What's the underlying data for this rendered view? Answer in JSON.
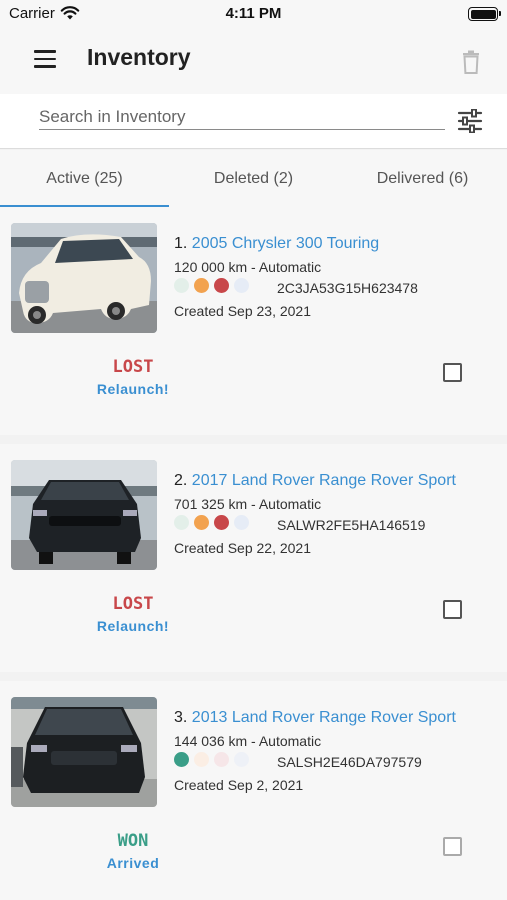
{
  "status_bar": {
    "carrier": "Carrier",
    "time": "4:11 PM"
  },
  "app_bar": {
    "title": "Inventory",
    "menu_icon": "menu-icon",
    "trash_icon": "trash-icon"
  },
  "search": {
    "placeholder": "Search in Inventory",
    "value": "",
    "filter_icon": "sliders-icon"
  },
  "tabs": [
    {
      "label": "Active (25)",
      "active": true
    },
    {
      "label": "Deleted (2)",
      "active": false
    },
    {
      "label": "Delivered (6)",
      "active": false
    }
  ],
  "colors": {
    "accent": "#3a8fd1",
    "lost": "#c8474a",
    "won": "#3a9e88"
  },
  "vehicles": [
    {
      "index": "1.",
      "name": "2005 Chrysler 300 Touring",
      "meta": "120 000 km - Automatic",
      "vin": "2C3JA53G15H623478",
      "created": "Created Sep 23, 2021",
      "dots": [
        "#e3efe9",
        "#f2a24f",
        "#c8474a",
        "#e6ecf6"
      ],
      "status": "LOST",
      "status_color": "#c8474a",
      "action": "Relaunch!",
      "checked": false
    },
    {
      "index": "2.",
      "name": "2017 Land Rover Range Rover Sport",
      "meta": "701 325 km - Automatic",
      "vin": "SALWR2FE5HA146519",
      "created": "Created Sep 22, 2021",
      "dots": [
        "#e3efe9",
        "#f2a24f",
        "#c8474a",
        "#e6ecf6"
      ],
      "status": "LOST",
      "status_color": "#c8474a",
      "action": "Relaunch!",
      "checked": false
    },
    {
      "index": "3.",
      "name": "2013 Land Rover Range Rover Sport",
      "meta": "144 036 km - Automatic",
      "vin": "SALSH2E46DA797579",
      "created": "Created Sep 2, 2021",
      "dots": [
        "#3a9e88",
        "#fbeee4",
        "#f6e6e8",
        "#eef1f7"
      ],
      "status": "WON",
      "status_color": "#3a9e88",
      "action": "Arrived",
      "checked": false
    }
  ]
}
